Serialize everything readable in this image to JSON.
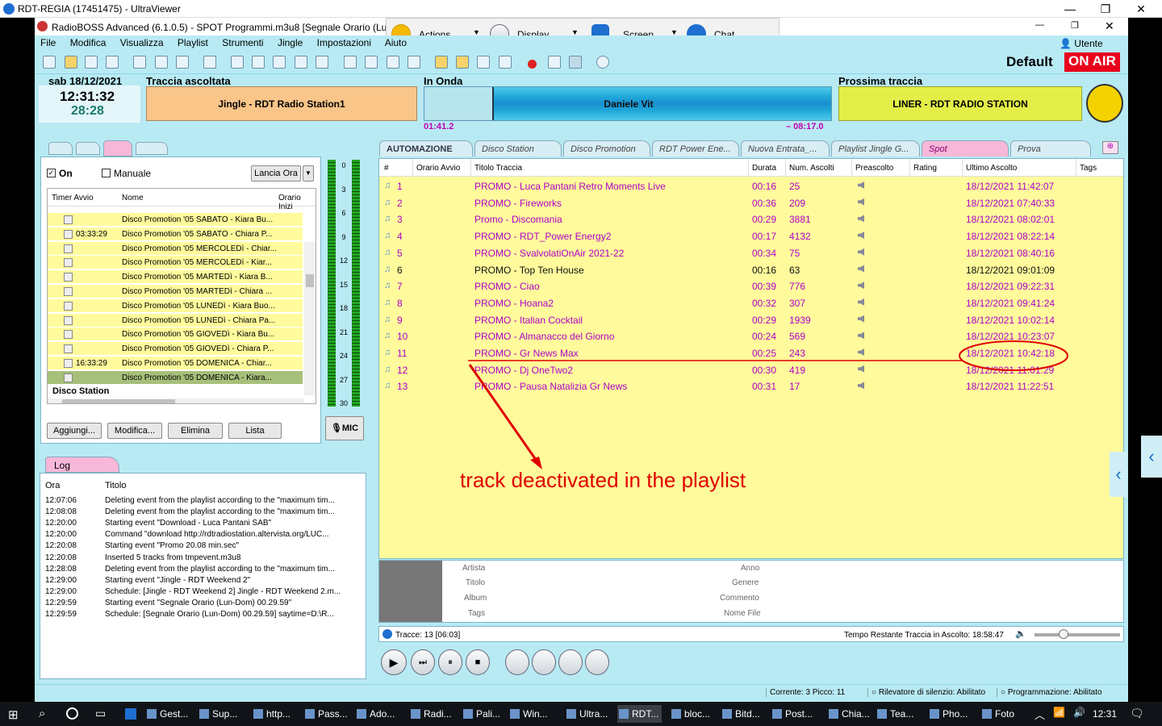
{
  "outer": {
    "title": "RDT-REGIA (17451475) - UltraViewer"
  },
  "app": {
    "title": "RadioBOSS Advanced (6.1.0.5) - SPOT Programmi.m3u8 [Segnale Orario (Lun-Dom)",
    "user": "Utente",
    "profile": "Default",
    "on_air": "ON AIR"
  },
  "uv_toolbar": {
    "actions": "Actions",
    "display": "Display",
    "screen": "Screen",
    "chat": "Chat"
  },
  "menu": [
    "File",
    "Modifica",
    "Visualizza",
    "Playlist",
    "Strumenti",
    "Jingle",
    "Impostazioni",
    "Aiuto"
  ],
  "clock": {
    "date": "sab 18/12/2021",
    "time": "12:31:32",
    "elapsed": "28:28"
  },
  "previous": {
    "label": "Traccia ascoltata",
    "track": "Jingle - RDT Radio Station1"
  },
  "onair": {
    "label": "In Onda",
    "track": "Daniele Vit",
    "elapsed": "01:41.2",
    "remaining": "– 08:17.0"
  },
  "next": {
    "label": "Prossima traccia",
    "track": "LINER - RDT RADIO STATION"
  },
  "scheduler": {
    "on_label": "On",
    "manual_label": "Manuale",
    "launch_btn": "Lancia Ora",
    "col_timer": "Timer Avvio",
    "col_name": "Nome",
    "col_start": "Orario Inizi",
    "rows": [
      {
        "t": "",
        "n": "Disco Promotion '05 SABATO - Kiara Bu..."
      },
      {
        "t": "03:33:29",
        "n": "Disco Promotion '05 SABATO - Chiara P..."
      },
      {
        "t": "",
        "n": "Disco Promotion '05 MERCOLEDì - Chiar..."
      },
      {
        "t": "",
        "n": "Disco Promotion '05 MERCOLEDì - Kiar..."
      },
      {
        "t": "",
        "n": "Disco Promotion '05 MARTEDì - Kiara B..."
      },
      {
        "t": "",
        "n": "Disco Promotion '05 MARTEDì - Chiara ..."
      },
      {
        "t": "",
        "n": "Disco Promotion '05 LUNEDì - Kiara Buo..."
      },
      {
        "t": "",
        "n": "Disco Promotion '05 LUNEDì - Chiara Pa..."
      },
      {
        "t": "",
        "n": "Disco Promotion '05 GIOVEDì - Kiara Bu..."
      },
      {
        "t": "",
        "n": "Disco Promotion '05 GIOVEDì - Chiara P..."
      },
      {
        "t": "16:33:29",
        "n": "Disco Promotion '05 DOMENICA - Chiar..."
      },
      {
        "t": "",
        "n": "Disco Promotion '05 DOMENICA - Kiara..."
      }
    ],
    "group": "Disco Station",
    "buttons": {
      "add": "Aggiungi...",
      "edit": "Modifica...",
      "delete": "Elimina",
      "list": "Lista"
    }
  },
  "meter": {
    "scale": [
      "0",
      "3",
      "6",
      "9",
      "12",
      "15",
      "18",
      "21",
      "24",
      "27",
      "30"
    ],
    "mic": "MIC"
  },
  "log": {
    "tab": "Log",
    "col_time": "Ora",
    "col_title": "Titolo",
    "rows": [
      {
        "t": "12:07:06",
        "m": "Deleting event from the playlist according to the \"maximum tim..."
      },
      {
        "t": "12:08:08",
        "m": "Deleting event from the playlist according to the \"maximum tim..."
      },
      {
        "t": "12:20:00",
        "m": "Starting event \"Download - Luca Pantani SAB\""
      },
      {
        "t": "12:20:00",
        "m": "Command \"download http://rdtradiostation.altervista.org/LUC..."
      },
      {
        "t": "12:20:08",
        "m": "Starting event \"Promo 20.08 min.sec\""
      },
      {
        "t": "12:20:08",
        "m": "Inserted 5 tracks from tmpevent.m3u8"
      },
      {
        "t": "12:28:08",
        "m": "Deleting event from the playlist according to the \"maximum tim..."
      },
      {
        "t": "12:29:00",
        "m": "Starting event \"Jingle - RDT Weekend 2\""
      },
      {
        "t": "12:29:00",
        "m": "Schedule: [Jingle - RDT Weekend 2] Jingle - RDT Weekend 2.m..."
      },
      {
        "t": "12:29:59",
        "m": "Starting event \"Segnale Orario (Lun-Dom) 00.29.59\""
      },
      {
        "t": "12:29:59",
        "m": "Schedule: [Segnale Orario (Lun-Dom) 00.29.59] saytime=D:\\R..."
      }
    ]
  },
  "tabs": [
    "AUTOMAZIONE",
    "Disco Station",
    "Disco Promotion",
    "RDT Power Ene...",
    "Nuova Entrata_...",
    "Playlist Jingle G...",
    "Spot",
    "Prova"
  ],
  "playlist": {
    "cols": [
      "#",
      "Orario Avvio",
      "Titolo Traccia",
      "Durata",
      "Num. Ascolti",
      "Preascolto",
      "Rating",
      "Ultimo Ascolto",
      "Tags"
    ],
    "rows": [
      {
        "n": "1",
        "title": "PROMO - Luca Pantani Retro Moments Live",
        "dur": "00:16",
        "plays": "25",
        "last": "18/12/2021 11:42:07"
      },
      {
        "n": "2",
        "title": "PROMO - Fireworks",
        "dur": "00:36",
        "plays": "209",
        "last": "18/12/2021 07:40:33"
      },
      {
        "n": "3",
        "title": "Promo - Discomania",
        "dur": "00:29",
        "plays": "3881",
        "last": "18/12/2021 08:02:01"
      },
      {
        "n": "4",
        "title": "PROMO - RDT_Power Energy2",
        "dur": "00:17",
        "plays": "4132",
        "last": "18/12/2021 08:22:14"
      },
      {
        "n": "5",
        "title": "PROMO - SvalvolatiOnAir 2021-22",
        "dur": "00:34",
        "plays": "75",
        "last": "18/12/2021 08:40:16"
      },
      {
        "n": "6",
        "title": "PROMO - Top Ten House",
        "dur": "00:16",
        "plays": "63",
        "last": "18/12/2021 09:01:09"
      },
      {
        "n": "7",
        "title": "PROMO - Ciao",
        "dur": "00:39",
        "plays": "776",
        "last": "18/12/2021 09:22:31"
      },
      {
        "n": "8",
        "title": "PROMO - Hoana2",
        "dur": "00:32",
        "plays": "307",
        "last": "18/12/2021 09:41:24"
      },
      {
        "n": "9",
        "title": "PROMO - Italian Cocktail",
        "dur": "00:29",
        "plays": "1939",
        "last": "18/12/2021 10:02:14"
      },
      {
        "n": "10",
        "title": "PROMO - Almanacco del Giorno",
        "dur": "00:24",
        "plays": "569",
        "last": "18/12/2021 10:23:07"
      },
      {
        "n": "11",
        "title": "PROMO - Gr News Max",
        "dur": "00:25",
        "plays": "243",
        "last": "18/12/2021 10:42:18"
      },
      {
        "n": "12",
        "title": "PROMO - Dj OneTwo2",
        "dur": "00:30",
        "plays": "419",
        "last": "18/12/2021 11:01:29"
      },
      {
        "n": "13",
        "title": "PROMO - Pausa Natalizia Gr News",
        "dur": "00:31",
        "plays": "17",
        "last": "18/12/2021 11:22:51"
      }
    ],
    "annotation": "track deactivated in the playlist"
  },
  "info": {
    "artist": "Artista",
    "title": "Titolo",
    "album": "Album",
    "tags": "Tags",
    "year": "Anno",
    "genre": "Genere",
    "comment": "Commento",
    "filename": "Nome File"
  },
  "status": {
    "tracks": "Tracce: 13 [06:03]",
    "remaining": "Tempo Restante Traccia in Ascolto: 18:58:47",
    "current": "Corrente: 3 Picco: 11",
    "silence": "Rilevatore di silenzio: Abilitato",
    "scheduling": "Programmazione: Abilitato"
  },
  "taskbar": {
    "items": [
      "Gest...",
      "Sup...",
      "http...",
      "Pass...",
      "Ado...",
      "Radi...",
      "Pali...",
      "Win...",
      "Ultra...",
      "RDT...",
      "bloc...",
      "Bitd...",
      "Post...",
      "Chia...",
      "Tea...",
      "Pho...",
      "Foto"
    ],
    "clock": "12:31"
  },
  "colors": {
    "app_bg": "#b8eaf4",
    "playlist_bg": "#fffb9c",
    "accent_purple": "#b000c8",
    "on_air_red": "#e8001c",
    "annotation_red": "#e00000"
  }
}
